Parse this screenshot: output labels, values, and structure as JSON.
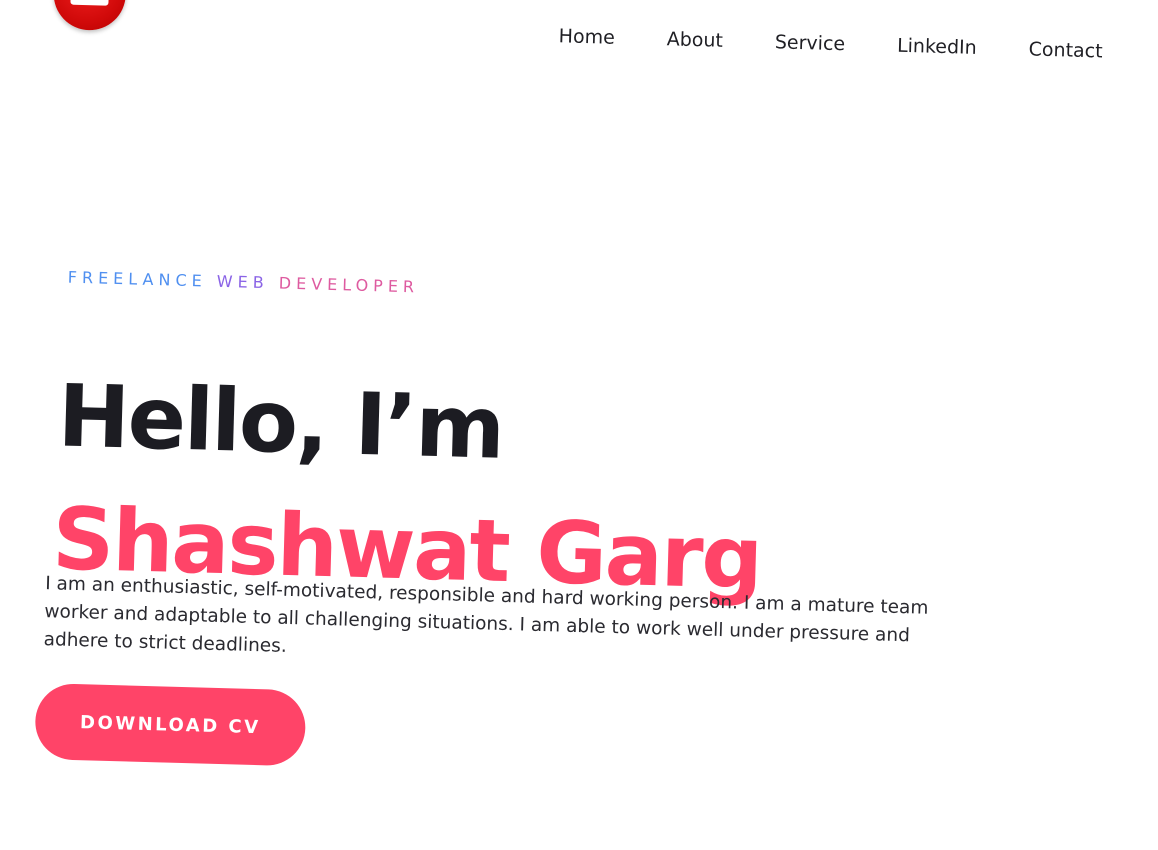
{
  "nav": {
    "items": [
      {
        "label": "Home"
      },
      {
        "label": "About"
      },
      {
        "label": "Service"
      },
      {
        "label": "LinkedIn"
      },
      {
        "label": "Contact"
      }
    ]
  },
  "hero": {
    "eyebrow": {
      "word1": "FREELANCE",
      "word2": "WEB",
      "word3": "DEVELOPER"
    },
    "greeting": "Hello, I’m",
    "name": "Shashwat Garg",
    "bio": "I am an enthusiastic, self-motivated, responsible and hard working person. I am a mature team worker and adaptable to all challenging situations. I am able to work well under pressure and adhere to strict deadlines.",
    "cta_label": "DOWNLOAD CV"
  },
  "icons": {
    "logo": "briefcase-icon"
  },
  "colors": {
    "accent": "#ff4468",
    "logo_red": "#d10a0a",
    "heading": "#1c1c22",
    "eyebrow_blue": "#4f8ff0",
    "eyebrow_purple": "#8a63e6",
    "eyebrow_pink": "#de5ba0"
  }
}
